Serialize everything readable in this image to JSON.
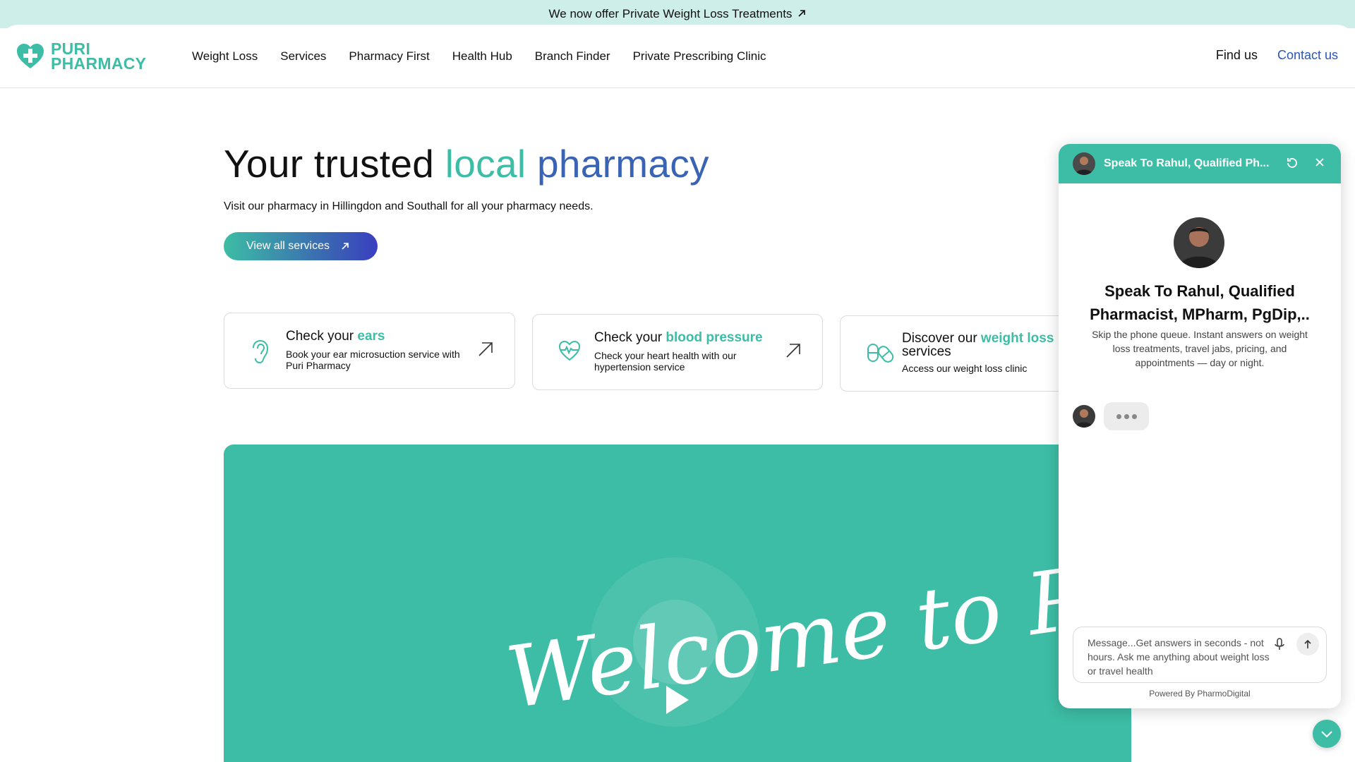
{
  "announcement": {
    "text": "We now offer Private Weight Loss Treatments"
  },
  "logo": {
    "line1": "PURI",
    "line2": "PHARMACY"
  },
  "nav": {
    "items": [
      {
        "label": "Weight Loss"
      },
      {
        "label": "Services"
      },
      {
        "label": "Pharmacy First"
      },
      {
        "label": "Health Hub"
      },
      {
        "label": "Branch Finder"
      },
      {
        "label": "Private Prescribing Clinic"
      }
    ],
    "find_us": "Find us",
    "contact_us": "Contact us"
  },
  "hero": {
    "title_part1": "Your trusted ",
    "title_local": "local",
    "title_pharmacy": " pharmacy",
    "subtitle": "Visit our pharmacy in Hillingdon and Southall for all your pharmacy needs.",
    "button_label": "View all services"
  },
  "cards": [
    {
      "icon": "ear-icon",
      "title_prefix": "Check your ",
      "title_highlight": "ears",
      "title_suffix": "",
      "description": "Book your ear microsuction service with Puri Pharmacy"
    },
    {
      "icon": "heart-pulse-icon",
      "title_prefix": "Check your ",
      "title_highlight": "blood pressure",
      "title_suffix": "",
      "description": "Check your heart health with our hypertension service"
    },
    {
      "icon": "pills-icon",
      "title_prefix": "Discover our ",
      "title_highlight": "weight loss",
      "title_suffix": " services",
      "description": "Access our weight loss clinic"
    }
  ],
  "video": {
    "text": "Welcome to Puri Pharmacy"
  },
  "chat": {
    "header_title": "Speak To Rahul, Qualified Ph...",
    "name": "Speak To Rahul, Qualified Pharmacist, MPharm, PgDip,..",
    "intro": "Skip the phone queue. Instant answers on weight loss treatments, travel jabs, pricing, and appointments — day or night.",
    "input_placeholder": "Message...Get answers in seconds - not hours. Ask me anything about weight loss or travel health",
    "powered_by": "Powered By PharmoDigital"
  },
  "colors": {
    "brand_teal": "#3dbda5",
    "brand_blue": "#3a63b3",
    "link_blue": "#2a57b8",
    "announce_bg": "#cdeee9"
  }
}
